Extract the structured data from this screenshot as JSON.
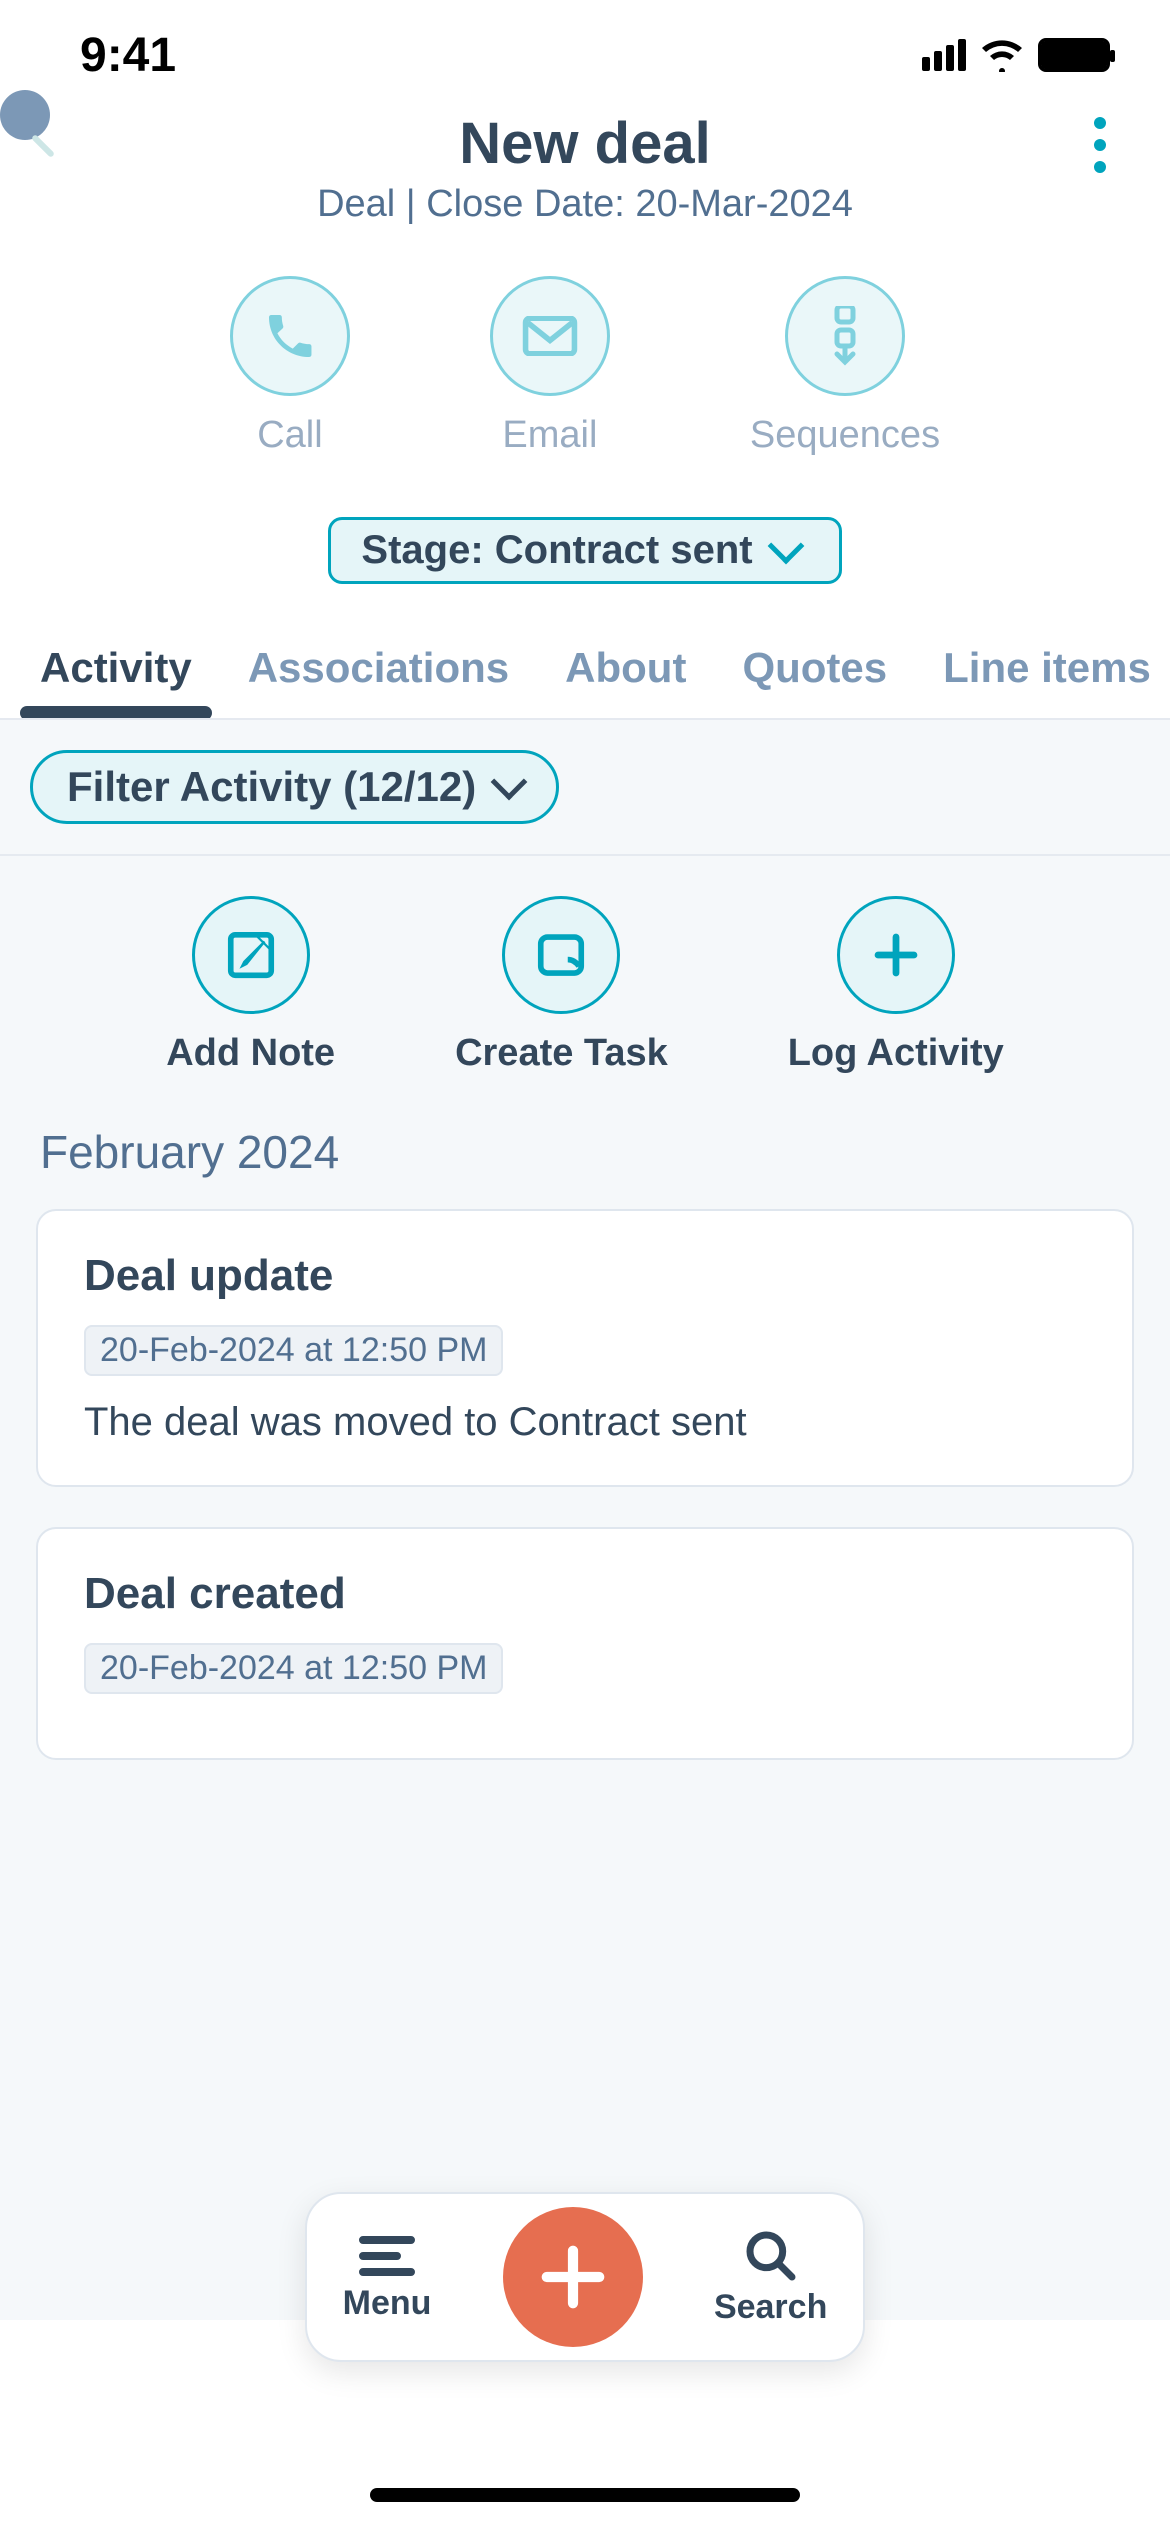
{
  "status": {
    "time": "9:41"
  },
  "header": {
    "title": "New deal",
    "subtitle": "Deal | Close Date: 20-Mar-2024"
  },
  "quick_actions": {
    "call": "Call",
    "email": "Email",
    "sequences": "Sequences"
  },
  "stage": {
    "label": "Stage: Contract sent"
  },
  "tabs": {
    "activity": "Activity",
    "associations": "Associations",
    "about": "About",
    "quotes": "Quotes",
    "line_items": "Line items"
  },
  "filter": {
    "label": "Filter Activity (12/12)"
  },
  "activity_actions": {
    "add_note": "Add Note",
    "create_task": "Create Task",
    "log_activity": "Log Activity"
  },
  "feed": {
    "month": "February 2024",
    "items": [
      {
        "title": "Deal update",
        "timestamp": "20-Feb-2024 at 12:50 PM",
        "body": "The deal was moved to Contract sent"
      },
      {
        "title": "Deal created",
        "timestamp": "20-Feb-2024 at 12:50 PM",
        "body": ""
      }
    ]
  },
  "bottom": {
    "menu": "Menu",
    "search": "Search"
  }
}
